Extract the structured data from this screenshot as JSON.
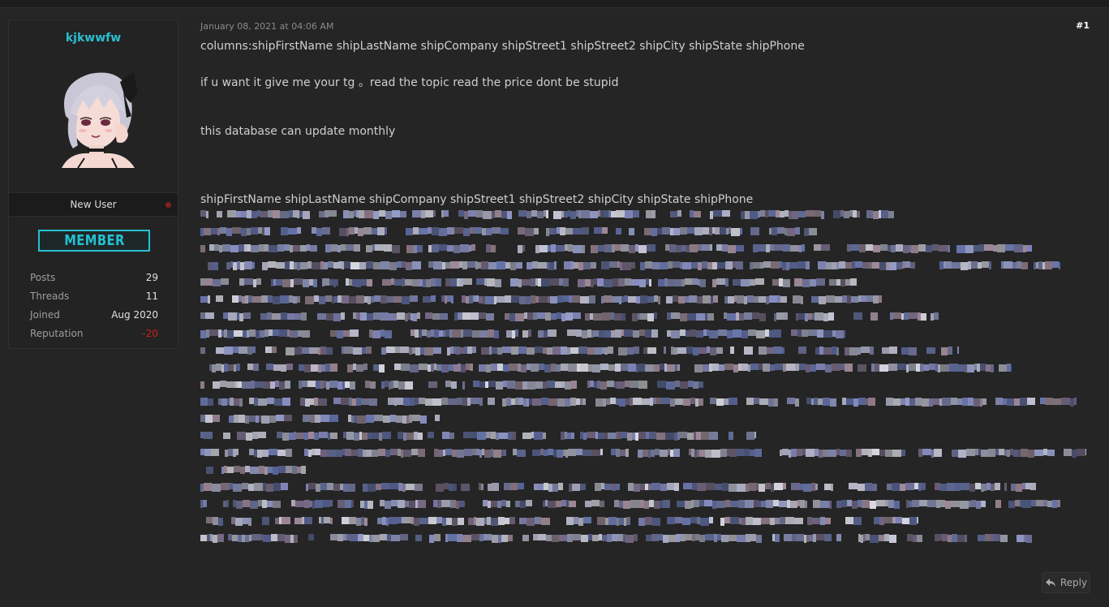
{
  "user": {
    "username": "kjkwwfw",
    "user_title": "New User",
    "rank_badge": "MEMBER",
    "stats": [
      {
        "label": "Posts",
        "value": "29"
      },
      {
        "label": "Threads",
        "value": "11"
      },
      {
        "label": "Joined",
        "value": "Aug 2020"
      },
      {
        "label": "Reputation",
        "value": "-20"
      }
    ]
  },
  "post": {
    "date": "January 08, 2021 at 04:06 AM",
    "number": "#1",
    "lines": [
      "columns:shipFirstName shipLastName shipCompany shipStreet1 shipStreet2 shipCity shipState shipPhone",
      "if u want it give me your tg 。read the topic read the price dont be stupid",
      "this database can update monthly",
      "shipFirstName shipLastName shipCompany shipStreet1 shipStreet2 shipCity shipState shipPhone"
    ]
  },
  "actions": {
    "reply_label": "Reply"
  },
  "colors": {
    "accent": "#2bbfd0",
    "negative": "#d01c1c",
    "background": "#252525"
  }
}
